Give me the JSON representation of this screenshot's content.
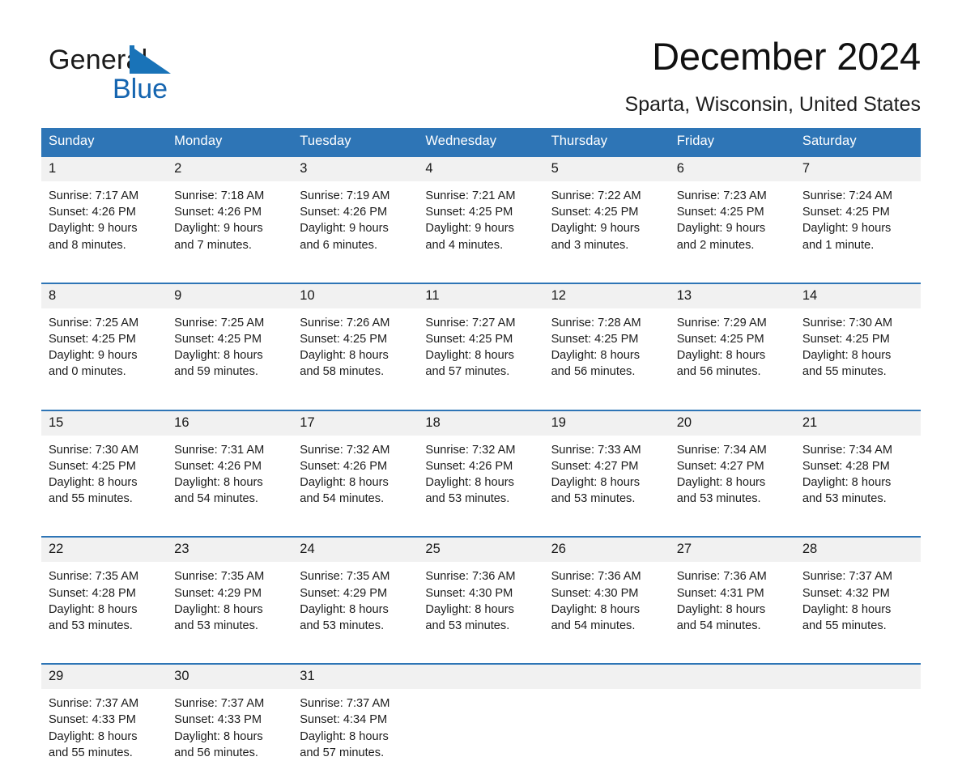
{
  "brand": {
    "word1": "General",
    "word2": "Blue",
    "triangle_color": "#1973b8",
    "text_color": "#1a1a1a",
    "blue_text_color": "#1565b0",
    "logo_icon": "right-triangle-icon"
  },
  "header": {
    "month_title": "December 2024",
    "location": "Sparta, Wisconsin, United States"
  },
  "theme": {
    "header_blue": "#2e75b6",
    "row_border_blue": "#2e75b6",
    "daynum_band": "#f1f1f1",
    "page_background": "#ffffff",
    "body_text": "#1c1c1c"
  },
  "weekday_headers": [
    "Sunday",
    "Monday",
    "Tuesday",
    "Wednesday",
    "Thursday",
    "Friday",
    "Saturday"
  ],
  "weeks": [
    [
      {
        "day": "1",
        "sunrise": "Sunrise: 7:17 AM",
        "sunset": "Sunset: 4:26 PM",
        "daylight_line1": "Daylight: 9 hours",
        "daylight_line2": "and 8 minutes."
      },
      {
        "day": "2",
        "sunrise": "Sunrise: 7:18 AM",
        "sunset": "Sunset: 4:26 PM",
        "daylight_line1": "Daylight: 9 hours",
        "daylight_line2": "and 7 minutes."
      },
      {
        "day": "3",
        "sunrise": "Sunrise: 7:19 AM",
        "sunset": "Sunset: 4:26 PM",
        "daylight_line1": "Daylight: 9 hours",
        "daylight_line2": "and 6 minutes."
      },
      {
        "day": "4",
        "sunrise": "Sunrise: 7:21 AM",
        "sunset": "Sunset: 4:25 PM",
        "daylight_line1": "Daylight: 9 hours",
        "daylight_line2": "and 4 minutes."
      },
      {
        "day": "5",
        "sunrise": "Sunrise: 7:22 AM",
        "sunset": "Sunset: 4:25 PM",
        "daylight_line1": "Daylight: 9 hours",
        "daylight_line2": "and 3 minutes."
      },
      {
        "day": "6",
        "sunrise": "Sunrise: 7:23 AM",
        "sunset": "Sunset: 4:25 PM",
        "daylight_line1": "Daylight: 9 hours",
        "daylight_line2": "and 2 minutes."
      },
      {
        "day": "7",
        "sunrise": "Sunrise: 7:24 AM",
        "sunset": "Sunset: 4:25 PM",
        "daylight_line1": "Daylight: 9 hours",
        "daylight_line2": "and 1 minute."
      }
    ],
    [
      {
        "day": "8",
        "sunrise": "Sunrise: 7:25 AM",
        "sunset": "Sunset: 4:25 PM",
        "daylight_line1": "Daylight: 9 hours",
        "daylight_line2": "and 0 minutes."
      },
      {
        "day": "9",
        "sunrise": "Sunrise: 7:25 AM",
        "sunset": "Sunset: 4:25 PM",
        "daylight_line1": "Daylight: 8 hours",
        "daylight_line2": "and 59 minutes."
      },
      {
        "day": "10",
        "sunrise": "Sunrise: 7:26 AM",
        "sunset": "Sunset: 4:25 PM",
        "daylight_line1": "Daylight: 8 hours",
        "daylight_line2": "and 58 minutes."
      },
      {
        "day": "11",
        "sunrise": "Sunrise: 7:27 AM",
        "sunset": "Sunset: 4:25 PM",
        "daylight_line1": "Daylight: 8 hours",
        "daylight_line2": "and 57 minutes."
      },
      {
        "day": "12",
        "sunrise": "Sunrise: 7:28 AM",
        "sunset": "Sunset: 4:25 PM",
        "daylight_line1": "Daylight: 8 hours",
        "daylight_line2": "and 56 minutes."
      },
      {
        "day": "13",
        "sunrise": "Sunrise: 7:29 AM",
        "sunset": "Sunset: 4:25 PM",
        "daylight_line1": "Daylight: 8 hours",
        "daylight_line2": "and 56 minutes."
      },
      {
        "day": "14",
        "sunrise": "Sunrise: 7:30 AM",
        "sunset": "Sunset: 4:25 PM",
        "daylight_line1": "Daylight: 8 hours",
        "daylight_line2": "and 55 minutes."
      }
    ],
    [
      {
        "day": "15",
        "sunrise": "Sunrise: 7:30 AM",
        "sunset": "Sunset: 4:25 PM",
        "daylight_line1": "Daylight: 8 hours",
        "daylight_line2": "and 55 minutes."
      },
      {
        "day": "16",
        "sunrise": "Sunrise: 7:31 AM",
        "sunset": "Sunset: 4:26 PM",
        "daylight_line1": "Daylight: 8 hours",
        "daylight_line2": "and 54 minutes."
      },
      {
        "day": "17",
        "sunrise": "Sunrise: 7:32 AM",
        "sunset": "Sunset: 4:26 PM",
        "daylight_line1": "Daylight: 8 hours",
        "daylight_line2": "and 54 minutes."
      },
      {
        "day": "18",
        "sunrise": "Sunrise: 7:32 AM",
        "sunset": "Sunset: 4:26 PM",
        "daylight_line1": "Daylight: 8 hours",
        "daylight_line2": "and 53 minutes."
      },
      {
        "day": "19",
        "sunrise": "Sunrise: 7:33 AM",
        "sunset": "Sunset: 4:27 PM",
        "daylight_line1": "Daylight: 8 hours",
        "daylight_line2": "and 53 minutes."
      },
      {
        "day": "20",
        "sunrise": "Sunrise: 7:34 AM",
        "sunset": "Sunset: 4:27 PM",
        "daylight_line1": "Daylight: 8 hours",
        "daylight_line2": "and 53 minutes."
      },
      {
        "day": "21",
        "sunrise": "Sunrise: 7:34 AM",
        "sunset": "Sunset: 4:28 PM",
        "daylight_line1": "Daylight: 8 hours",
        "daylight_line2": "and 53 minutes."
      }
    ],
    [
      {
        "day": "22",
        "sunrise": "Sunrise: 7:35 AM",
        "sunset": "Sunset: 4:28 PM",
        "daylight_line1": "Daylight: 8 hours",
        "daylight_line2": "and 53 minutes."
      },
      {
        "day": "23",
        "sunrise": "Sunrise: 7:35 AM",
        "sunset": "Sunset: 4:29 PM",
        "daylight_line1": "Daylight: 8 hours",
        "daylight_line2": "and 53 minutes."
      },
      {
        "day": "24",
        "sunrise": "Sunrise: 7:35 AM",
        "sunset": "Sunset: 4:29 PM",
        "daylight_line1": "Daylight: 8 hours",
        "daylight_line2": "and 53 minutes."
      },
      {
        "day": "25",
        "sunrise": "Sunrise: 7:36 AM",
        "sunset": "Sunset: 4:30 PM",
        "daylight_line1": "Daylight: 8 hours",
        "daylight_line2": "and 53 minutes."
      },
      {
        "day": "26",
        "sunrise": "Sunrise: 7:36 AM",
        "sunset": "Sunset: 4:30 PM",
        "daylight_line1": "Daylight: 8 hours",
        "daylight_line2": "and 54 minutes."
      },
      {
        "day": "27",
        "sunrise": "Sunrise: 7:36 AM",
        "sunset": "Sunset: 4:31 PM",
        "daylight_line1": "Daylight: 8 hours",
        "daylight_line2": "and 54 minutes."
      },
      {
        "day": "28",
        "sunrise": "Sunrise: 7:37 AM",
        "sunset": "Sunset: 4:32 PM",
        "daylight_line1": "Daylight: 8 hours",
        "daylight_line2": "and 55 minutes."
      }
    ],
    [
      {
        "day": "29",
        "sunrise": "Sunrise: 7:37 AM",
        "sunset": "Sunset: 4:33 PM",
        "daylight_line1": "Daylight: 8 hours",
        "daylight_line2": "and 55 minutes."
      },
      {
        "day": "30",
        "sunrise": "Sunrise: 7:37 AM",
        "sunset": "Sunset: 4:33 PM",
        "daylight_line1": "Daylight: 8 hours",
        "daylight_line2": "and 56 minutes."
      },
      {
        "day": "31",
        "sunrise": "Sunrise: 7:37 AM",
        "sunset": "Sunset: 4:34 PM",
        "daylight_line1": "Daylight: 8 hours",
        "daylight_line2": "and 57 minutes."
      },
      {
        "day": "",
        "sunrise": "",
        "sunset": "",
        "daylight_line1": "",
        "daylight_line2": ""
      },
      {
        "day": "",
        "sunrise": "",
        "sunset": "",
        "daylight_line1": "",
        "daylight_line2": ""
      },
      {
        "day": "",
        "sunrise": "",
        "sunset": "",
        "daylight_line1": "",
        "daylight_line2": ""
      },
      {
        "day": "",
        "sunrise": "",
        "sunset": "",
        "daylight_line1": "",
        "daylight_line2": ""
      }
    ]
  ]
}
